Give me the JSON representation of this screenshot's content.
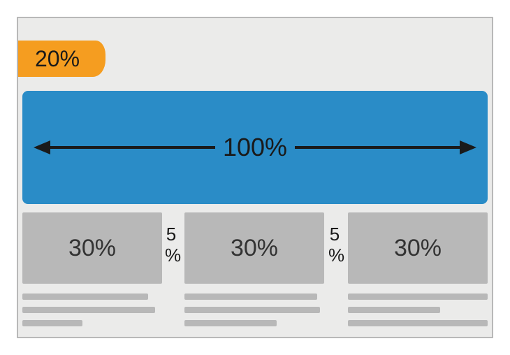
{
  "tab_label": "20%",
  "hero_label": "100%",
  "columns": {
    "c1": "30%",
    "c2": "30%",
    "c3": "30%"
  },
  "gap_num": "5",
  "gap_pct": "%",
  "colors": {
    "orange": "#f59d20",
    "blue": "#2a8cc7",
    "grey": "#b8b8b8",
    "bg": "#ebebea"
  }
}
